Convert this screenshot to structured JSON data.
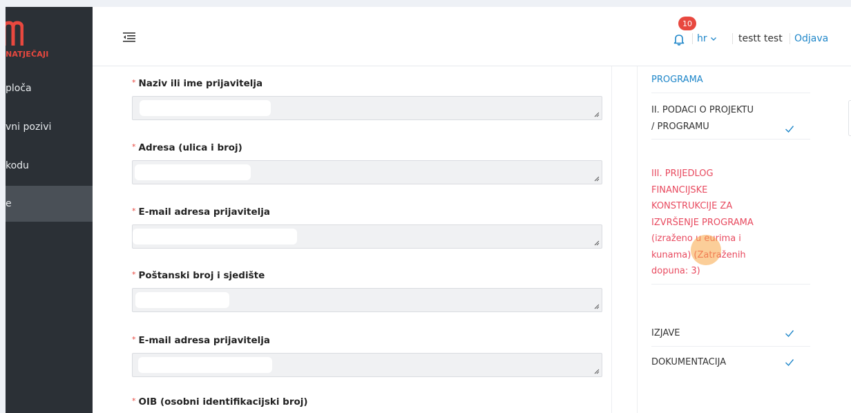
{
  "brand": {
    "logo_letter": "m",
    "subtitle": "NATJEČAJI",
    "accent": "#e8483f"
  },
  "sidebar": {
    "items": [
      {
        "label": "ploča",
        "active": false
      },
      {
        "label": "vni pozivi",
        "active": false
      },
      {
        "label": "kodu",
        "active": false
      },
      {
        "label": "e",
        "active": true
      }
    ]
  },
  "header": {
    "menu_icon": "menu-collapse-icon",
    "notifications": {
      "icon": "bell-icon",
      "count": "10"
    },
    "language": "hr",
    "user_name": "testt test",
    "logout_label": "Odjava"
  },
  "form": {
    "fields": [
      {
        "label": "Naziv ili ime prijavitelja",
        "value": ""
      },
      {
        "label": "Adresa (ulica i broj)",
        "value": ""
      },
      {
        "label": "E-mail adresa prijavitelja",
        "value": ""
      },
      {
        "label": "Poštanski broj i sjedište",
        "value": ""
      },
      {
        "label": "E-mail adresa prijavitelja",
        "value": ""
      },
      {
        "label": "OIB (osobni identifikacijski broj)",
        "value": ""
      }
    ],
    "required_marker": "*"
  },
  "steps": {
    "items": [
      {
        "label": "PROGRAMA",
        "color": "blue",
        "checked": false
      },
      {
        "label": "II. PODACI O PROJEKTU / PROGRAMU",
        "color": "dark",
        "checked": true
      },
      {
        "label": "III. PRIJEDLOG FINANCIJSKE KONSTRUKCIJE ZA IZVRŠENJE PROGRAMA (izraženo u eurima i kunama) (Zatraženih dopuna: 3)",
        "color": "red",
        "checked": false
      },
      {
        "label": "IZJAVE",
        "color": "dark",
        "checked": true
      },
      {
        "label": "DOKUMENTACIJA",
        "color": "dark",
        "checked": true
      }
    ],
    "check_icon": "checkmark-icon"
  },
  "colors": {
    "link": "#1e86c9",
    "error": "#e84a5f",
    "sidebar_bg": "#2b3036"
  }
}
